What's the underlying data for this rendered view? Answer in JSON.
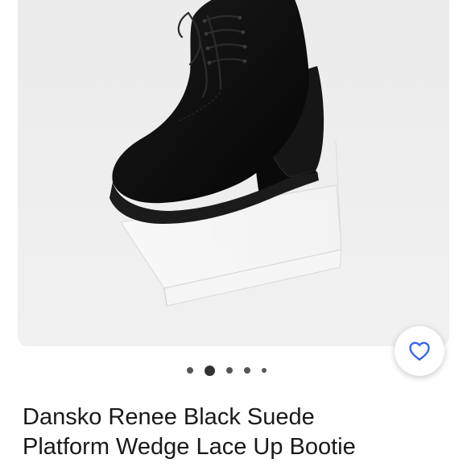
{
  "product": {
    "title_line_1": "Dansko Renee Black Suede",
    "title_line_2": "Platform Wedge Lace Up Bootie"
  },
  "carousel": {
    "total_dots": 5,
    "active_index": 1
  },
  "icons": {
    "favorite": "heart-outline-icon"
  },
  "colors": {
    "accent": "#3665f3",
    "title_text": "#191919",
    "photo_background": "#eeeeee"
  }
}
